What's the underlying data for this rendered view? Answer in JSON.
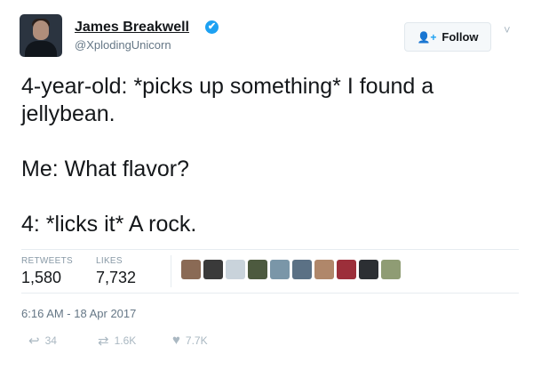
{
  "author": {
    "name": "James Breakwell",
    "handle": "@XplodingUnicorn",
    "verified_glyph": "✔"
  },
  "follow_button": {
    "icon": "👤+",
    "label": "Follow"
  },
  "caret": "˅",
  "tweet": {
    "line1": "4-year-old: *picks up something* I found a",
    "line2": "jellybean.",
    "line3": "Me: What flavor?",
    "line4": "4: *licks it* A rock."
  },
  "stats": {
    "retweets_label": "RETWEETS",
    "retweets_value": "1,580",
    "likes_label": "LIKES",
    "likes_value": "7,732"
  },
  "likers": [
    {
      "icon": "liker-avatar",
      "color": "#8a6a55"
    },
    {
      "icon": "liker-avatar",
      "color": "#3a3a3a"
    },
    {
      "icon": "liker-avatar",
      "color": "#c9d3db"
    },
    {
      "icon": "liker-avatar",
      "color": "#4d5a3f"
    },
    {
      "icon": "liker-avatar",
      "color": "#7a96a8"
    },
    {
      "icon": "liker-avatar",
      "color": "#5b7185"
    },
    {
      "icon": "liker-avatar",
      "color": "#b0876a"
    },
    {
      "icon": "liker-avatar",
      "color": "#9c2f3a"
    },
    {
      "icon": "liker-avatar",
      "color": "#2c2f33"
    },
    {
      "icon": "liker-avatar",
      "color": "#8f9c74"
    }
  ],
  "timestamp": "6:16 AM - 18 Apr 2017",
  "actions": {
    "reply_icon": "↩",
    "reply_count": "34",
    "retweet_icon": "⇄",
    "retweet_count": "1.6K",
    "like_icon": "♥",
    "like_count": "7.7K"
  },
  "colors": {
    "accent": "#1da1f2",
    "text": "#14171a",
    "muted": "#657786"
  }
}
